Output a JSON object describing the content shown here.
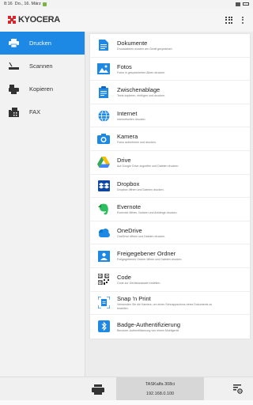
{
  "status_bar": {
    "time": "8:16",
    "date": "Do., 16. März"
  },
  "app": {
    "logo_text": "KYOCERA",
    "brand_color": "#d9262e"
  },
  "accent_color": "#1e88e5",
  "sidebar": {
    "items": [
      {
        "label": "Drucken",
        "icon": "printer-icon",
        "active": true
      },
      {
        "label": "Scannen",
        "icon": "scanner-icon",
        "active": false
      },
      {
        "label": "Kopieren",
        "icon": "copy-icon",
        "active": false
      },
      {
        "label": "FAX",
        "icon": "fax-icon",
        "active": false
      }
    ]
  },
  "print_options": [
    {
      "title": "Dokumente",
      "sub": "Druckdateien wurden am Gerät gespeichert.",
      "icon": "document-icon"
    },
    {
      "title": "Fotos",
      "sub": "Fotos in gespeicherten Alben drucken.",
      "icon": "photo-icon"
    },
    {
      "title": "Zwischenablage",
      "sub": "Texte kopieren, einfügen und drucken.",
      "icon": "clipboard-icon"
    },
    {
      "title": "Internet",
      "sub": "Internetseiten drucken.",
      "icon": "globe-icon"
    },
    {
      "title": "Kamera",
      "sub": "Fotos aufnehmen und drucken.",
      "icon": "camera-icon"
    },
    {
      "title": "Drive",
      "sub": "Auf Google Drive zugreifen und Dateien drucken.",
      "icon": "google-drive-icon"
    },
    {
      "title": "Dropbox",
      "sub": "Dropbox öffnen und Dateien drucken.",
      "icon": "dropbox-icon"
    },
    {
      "title": "Evernote",
      "sub": "Evernote öffnen, Notizen und Anhänge drucken.",
      "icon": "evernote-icon"
    },
    {
      "title": "OneDrive",
      "sub": "OneDrive öffnen und Dateien drucken.",
      "icon": "onedrive-icon"
    },
    {
      "title": "Freigegebener Ordner",
      "sub": "Freigegebenen Ordner öffnen und Dateien drucken.",
      "icon": "shared-folder-icon"
    },
    {
      "title": "Code",
      "sub": "Code zur Geräteauswahl erstellen.",
      "icon": "qr-code-icon"
    },
    {
      "title": "Snap 'n Print",
      "sub": "Verwenden Sie die Kamera, um einen Schnappschuss eines Dokuments zu",
      "sub2": "erstellen.",
      "icon": "snap-print-icon"
    },
    {
      "title": "Badge-Authentifizierung",
      "sub": "Benutzer-Authentifizierung von einem Mobilgerät.",
      "icon": "badge-auth-icon"
    }
  ],
  "device": {
    "name": "TASKalfa 308ci",
    "ip": "192.168.0.100"
  }
}
